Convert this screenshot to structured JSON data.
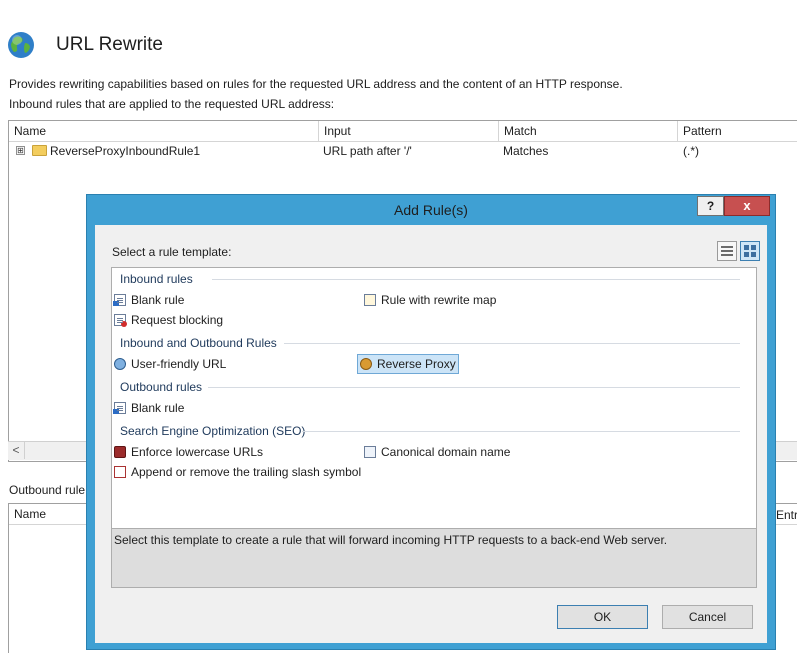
{
  "header": {
    "title": "URL Rewrite",
    "description": "Provides rewriting capabilities based on rules for the requested URL address and the content of an HTTP response.",
    "inbound_caption": "Inbound rules that are applied to the requested URL address:"
  },
  "inbound_grid": {
    "columns": [
      "Name",
      "Input",
      "Match",
      "Pattern"
    ],
    "rows": [
      {
        "expander": "⊞",
        "name": "ReverseProxyInboundRule1",
        "input": "URL path after '/'",
        "match": "Matches",
        "pattern": "(.*)"
      }
    ],
    "scroll_left": "<"
  },
  "outbound": {
    "label": "Outbound rule",
    "columns": [
      "Name"
    ],
    "trailing_fragment": "Entry"
  },
  "dialog": {
    "title": "Add Rule(s)",
    "help": "?",
    "close": "x",
    "select_label": "Select a rule template:",
    "groups": [
      {
        "title": "Inbound rules",
        "items": [
          {
            "label": "Blank rule",
            "icon": "blank-rule-icon"
          },
          {
            "label": "Rule with rewrite map",
            "icon": "rewrite-map-icon"
          },
          {
            "label": "Request blocking",
            "icon": "request-blocking-icon"
          }
        ]
      },
      {
        "title": "Inbound and Outbound Rules",
        "items": [
          {
            "label": "User-friendly URL",
            "icon": "user-friendly-url-icon"
          },
          {
            "label": "Reverse Proxy",
            "icon": "reverse-proxy-icon",
            "selected": true
          }
        ]
      },
      {
        "title": "Outbound rules",
        "items": [
          {
            "label": "Blank rule",
            "icon": "outbound-blank-rule-icon"
          }
        ]
      },
      {
        "title": "Search Engine Optimization (SEO)",
        "items": [
          {
            "label": "Enforce lowercase URLs",
            "icon": "lowercase-icon"
          },
          {
            "label": "Canonical domain name",
            "icon": "canonical-domain-icon"
          },
          {
            "label": "Append or remove the trailing slash symbol",
            "icon": "trailing-slash-icon"
          }
        ]
      }
    ],
    "description": "Select this template to create a rule that will forward incoming HTTP requests to a back-end Web server.",
    "ok": "OK",
    "cancel": "Cancel"
  },
  "colors": {
    "dialog_frame": "#3fa0d3",
    "close_button": "#c75050",
    "selection": "#cce4f7"
  }
}
